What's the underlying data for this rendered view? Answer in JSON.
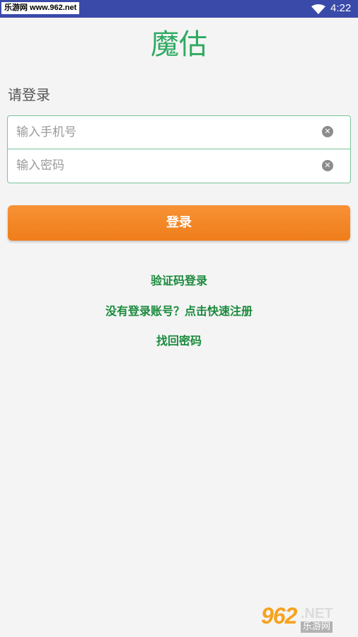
{
  "status_bar": {
    "watermark": "乐游网 www.962.net",
    "time": "4:22"
  },
  "app": {
    "title": "魔估"
  },
  "login": {
    "heading": "请登录",
    "phone_placeholder": "输入手机号",
    "password_placeholder": "输入密码",
    "clear_glyph": "✕",
    "submit_label": "登录"
  },
  "links": {
    "sms_login": "验证码登录",
    "register": "没有登录账号？点击快速注册",
    "recover": "找回密码"
  },
  "watermark_bottom": {
    "number": "962",
    "suffix": ".NET",
    "name": "乐游网"
  },
  "colors": {
    "statusbar": "#3a4aa8",
    "brand": "#2eaa62",
    "button": "#f28520",
    "link": "#1a8a3c"
  }
}
